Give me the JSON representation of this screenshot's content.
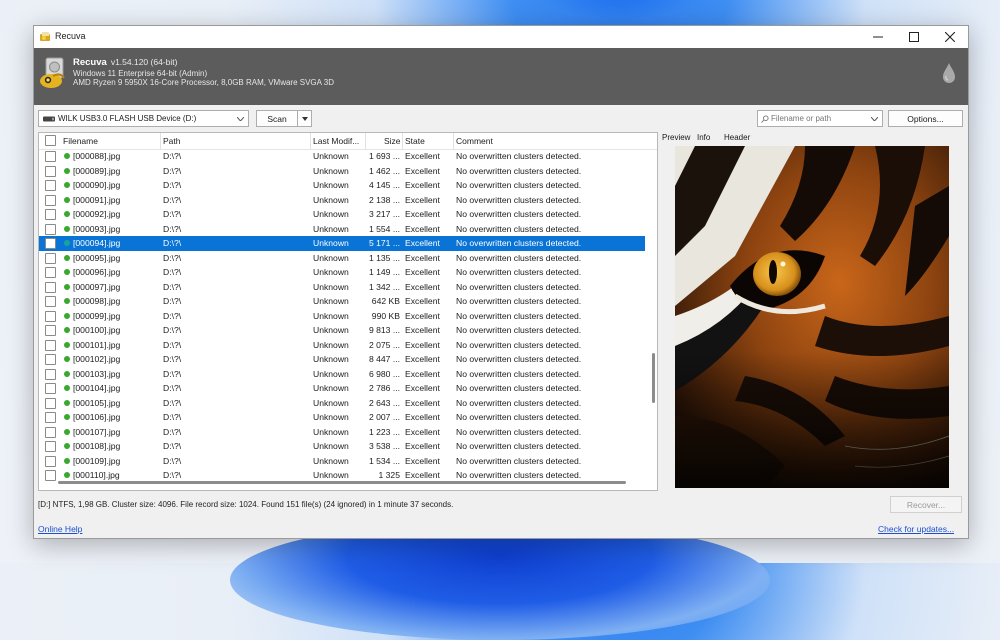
{
  "window": {
    "title": "Recuva"
  },
  "header": {
    "app_name": "Recuva",
    "version": "v1.54.120 (64-bit)",
    "os": "Windows 11 Enterprise 64-bit (Admin)",
    "hardware": "AMD Ryzen 9 5950X 16-Core Processor, 8,0GB RAM, VMware SVGA 3D"
  },
  "toolbar": {
    "drive": "WILK USB3.0 FLASH USB Device (D:)",
    "scan_label": "Scan",
    "search_placeholder": "Filename or path",
    "options_label": "Options..."
  },
  "columns": [
    "Filename",
    "Path",
    "Last Modif...",
    "Size",
    "State",
    "Comment"
  ],
  "files": [
    {
      "name": "[000088].jpg",
      "path": "D:\\?\\",
      "modified": "Unknown",
      "size": "1 693 ...",
      "state": "Excellent",
      "comment": "No overwritten clusters detected."
    },
    {
      "name": "[000089].jpg",
      "path": "D:\\?\\",
      "modified": "Unknown",
      "size": "1 462 ...",
      "state": "Excellent",
      "comment": "No overwritten clusters detected."
    },
    {
      "name": "[000090].jpg",
      "path": "D:\\?\\",
      "modified": "Unknown",
      "size": "4 145 ...",
      "state": "Excellent",
      "comment": "No overwritten clusters detected."
    },
    {
      "name": "[000091].jpg",
      "path": "D:\\?\\",
      "modified": "Unknown",
      "size": "2 138 ...",
      "state": "Excellent",
      "comment": "No overwritten clusters detected."
    },
    {
      "name": "[000092].jpg",
      "path": "D:\\?\\",
      "modified": "Unknown",
      "size": "3 217 ...",
      "state": "Excellent",
      "comment": "No overwritten clusters detected."
    },
    {
      "name": "[000093].jpg",
      "path": "D:\\?\\",
      "modified": "Unknown",
      "size": "1 554 ...",
      "state": "Excellent",
      "comment": "No overwritten clusters detected."
    },
    {
      "name": "[000094].jpg",
      "path": "D:\\?\\",
      "modified": "Unknown",
      "size": "5 171 ...",
      "state": "Excellent",
      "comment": "No overwritten clusters detected."
    },
    {
      "name": "[000095].jpg",
      "path": "D:\\?\\",
      "modified": "Unknown",
      "size": "1 135 ...",
      "state": "Excellent",
      "comment": "No overwritten clusters detected."
    },
    {
      "name": "[000096].jpg",
      "path": "D:\\?\\",
      "modified": "Unknown",
      "size": "1 149 ...",
      "state": "Excellent",
      "comment": "No overwritten clusters detected."
    },
    {
      "name": "[000097].jpg",
      "path": "D:\\?\\",
      "modified": "Unknown",
      "size": "1 342 ...",
      "state": "Excellent",
      "comment": "No overwritten clusters detected."
    },
    {
      "name": "[000098].jpg",
      "path": "D:\\?\\",
      "modified": "Unknown",
      "size": "642 KB",
      "state": "Excellent",
      "comment": "No overwritten clusters detected."
    },
    {
      "name": "[000099].jpg",
      "path": "D:\\?\\",
      "modified": "Unknown",
      "size": "990 KB",
      "state": "Excellent",
      "comment": "No overwritten clusters detected."
    },
    {
      "name": "[000100].jpg",
      "path": "D:\\?\\",
      "modified": "Unknown",
      "size": "9 813 ...",
      "state": "Excellent",
      "comment": "No overwritten clusters detected."
    },
    {
      "name": "[000101].jpg",
      "path": "D:\\?\\",
      "modified": "Unknown",
      "size": "2 075 ...",
      "state": "Excellent",
      "comment": "No overwritten clusters detected."
    },
    {
      "name": "[000102].jpg",
      "path": "D:\\?\\",
      "modified": "Unknown",
      "size": "8 447 ...",
      "state": "Excellent",
      "comment": "No overwritten clusters detected."
    },
    {
      "name": "[000103].jpg",
      "path": "D:\\?\\",
      "modified": "Unknown",
      "size": "6 980 ...",
      "state": "Excellent",
      "comment": "No overwritten clusters detected."
    },
    {
      "name": "[000104].jpg",
      "path": "D:\\?\\",
      "modified": "Unknown",
      "size": "2 786 ...",
      "state": "Excellent",
      "comment": "No overwritten clusters detected."
    },
    {
      "name": "[000105].jpg",
      "path": "D:\\?\\",
      "modified": "Unknown",
      "size": "2 643 ...",
      "state": "Excellent",
      "comment": "No overwritten clusters detected."
    },
    {
      "name": "[000106].jpg",
      "path": "D:\\?\\",
      "modified": "Unknown",
      "size": "2 007 ...",
      "state": "Excellent",
      "comment": "No overwritten clusters detected."
    },
    {
      "name": "[000107].jpg",
      "path": "D:\\?\\",
      "modified": "Unknown",
      "size": "1 223 ...",
      "state": "Excellent",
      "comment": "No overwritten clusters detected."
    },
    {
      "name": "[000108].jpg",
      "path": "D:\\?\\",
      "modified": "Unknown",
      "size": "3 538 ...",
      "state": "Excellent",
      "comment": "No overwritten clusters detected."
    },
    {
      "name": "[000109].jpg",
      "path": "D:\\?\\",
      "modified": "Unknown",
      "size": "1 534 ...",
      "state": "Excellent",
      "comment": "No overwritten clusters detected."
    },
    {
      "name": "[000110].jpg",
      "path": "D:\\?\\",
      "modified": "Unknown",
      "size": "1 325",
      "state": "Excellent",
      "comment": "No overwritten clusters detected."
    }
  ],
  "selected_index": 6,
  "preview": {
    "tabs": [
      "Preview",
      "Info",
      "Header"
    ]
  },
  "status": "[D:] NTFS, 1,98 GB. Cluster size: 4096. File record size: 1024. Found 151 file(s) (24 ignored) in 1 minute 37 seconds.",
  "recover_label": "Recover...",
  "footer": {
    "help_link": "Online Help",
    "updates_link": "Check for updates..."
  },
  "colors": {
    "accent": "#0a74d6",
    "header_bg": "#5c5c5c",
    "status_good": "#3aa82e",
    "link": "#1f4fd1"
  }
}
